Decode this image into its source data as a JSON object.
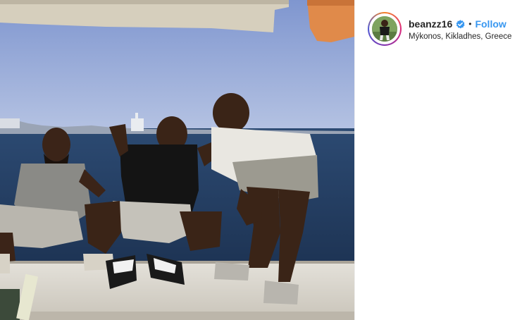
{
  "post": {
    "username": "beanzz16",
    "separator": "•",
    "follow_label": "Follow",
    "location": "Mýkonos, Kikladhes, Greece",
    "verified_icon": "verified-badge-icon",
    "colors": {
      "follow_blue": "#3897f0",
      "verified_blue": "#3897f0",
      "text": "#262626"
    }
  }
}
